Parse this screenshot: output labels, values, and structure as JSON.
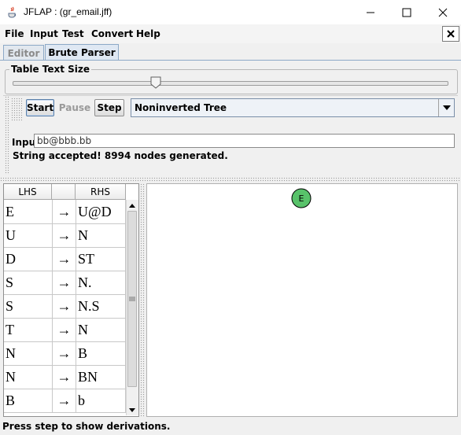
{
  "window": {
    "title": "JFLAP : (gr_email.jff)",
    "minimize_icon": "minimize-icon",
    "maximize_icon": "maximize-icon",
    "close_icon": "close-icon"
  },
  "menu": {
    "items": [
      "File",
      "Input",
      "Test",
      "Convert",
      "Help"
    ],
    "close_label": "✕"
  },
  "tabs": [
    {
      "label": "Editor",
      "active": false
    },
    {
      "label": "Brute Parser",
      "active": true
    }
  ],
  "table_text_size": {
    "label": "Table Text Size",
    "slider_value": 0.33
  },
  "toolbar": {
    "start_label": "Start",
    "pause_label": "Pause",
    "step_label": "Step",
    "combo_value": "Noninverted Tree"
  },
  "input": {
    "label": "Input",
    "value": "bb@bbb.bb"
  },
  "status_message": "String accepted!  8994 nodes generated.",
  "grammar_table": {
    "headers": [
      "LHS",
      "",
      "RHS"
    ],
    "rows": [
      {
        "lhs": "E",
        "arrow": "→",
        "rhs": "U@D"
      },
      {
        "lhs": "U",
        "arrow": "→",
        "rhs": "N"
      },
      {
        "lhs": "D",
        "arrow": "→",
        "rhs": "ST"
      },
      {
        "lhs": "S",
        "arrow": "→",
        "rhs": "N."
      },
      {
        "lhs": "S",
        "arrow": "→",
        "rhs": "N.S"
      },
      {
        "lhs": "T",
        "arrow": "→",
        "rhs": "N"
      },
      {
        "lhs": "N",
        "arrow": "→",
        "rhs": "B"
      },
      {
        "lhs": "N",
        "arrow": "→",
        "rhs": "BN"
      },
      {
        "lhs": "B",
        "arrow": "→",
        "rhs": "b"
      }
    ]
  },
  "tree": {
    "root_label": "E",
    "node_color": "#58c26a"
  },
  "statusbar": {
    "text": "Press step to show derivations."
  }
}
